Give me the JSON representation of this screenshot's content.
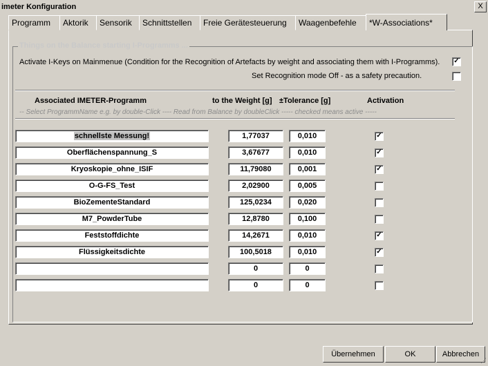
{
  "window": {
    "title": "imeter Konfiguration",
    "close_glyph": "X"
  },
  "tabs": [
    {
      "label": "Programm"
    },
    {
      "label": "Aktorik"
    },
    {
      "label": "Sensorik"
    },
    {
      "label": "Schnittstellen"
    },
    {
      "label": "Freie Gerätesteuerung"
    },
    {
      "label": "Waagenbefehle"
    },
    {
      "label": "*W-Associations*"
    }
  ],
  "group": {
    "label": "Things on the Balance starting I-Programms ...",
    "activate_text": "Activate I-Keys on Mainmenue (Condition for the Recognition of Artefacts by weight and associating them with I-Programms).",
    "activate_checked": true,
    "recognition_off_text": "Set Recognition mode Off - as a safety precaution.",
    "recognition_off_checked": false
  },
  "headers": {
    "program": "Associated IMETER-Programm",
    "weight": "to the Weight [g]",
    "tolerance": "±Tolerance [g]",
    "activation": "Activation"
  },
  "hint": "-- Select ProgrammName e.g. by double-Click  ---- Read from Balance by doubleClick  -----  checked means active -----",
  "rows": [
    {
      "program": "schnellste Messung!",
      "weight": "1,77037",
      "tolerance": "0,010",
      "active": true
    },
    {
      "program": "Oberflächenspannung_S",
      "weight": "3,67677",
      "tolerance": "0,010",
      "active": true
    },
    {
      "program": "Kryoskopie_ohne_ISIF",
      "weight": "11,79080",
      "tolerance": "0,001",
      "active": true
    },
    {
      "program": "O-G-FS_Test",
      "weight": "2,02900",
      "tolerance": "0,005",
      "active": false
    },
    {
      "program": "BioZementeStandard",
      "weight": "125,0234",
      "tolerance": "0,020",
      "active": false
    },
    {
      "program": "M7_PowderTube",
      "weight": "12,8780",
      "tolerance": "0,100",
      "active": false
    },
    {
      "program": "Feststoffdichte",
      "weight": "14,2671",
      "tolerance": "0,010",
      "active": true
    },
    {
      "program": "Flüssigkeitsdichte",
      "weight": "100,5018",
      "tolerance": "0,010",
      "active": true
    },
    {
      "program": "",
      "weight": "0",
      "tolerance": "0",
      "active": false
    },
    {
      "program": "",
      "weight": "0",
      "tolerance": "0",
      "active": false
    }
  ],
  "buttons": {
    "apply": "Übernehmen",
    "ok": "OK",
    "cancel": "Abbrechen"
  }
}
